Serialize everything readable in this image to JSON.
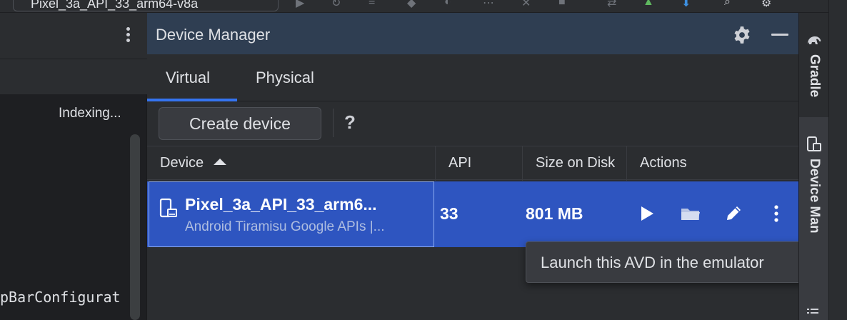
{
  "toolbar": {
    "run_config": "Pixel_3a_API_33_arm64-v8a"
  },
  "left_panel": {
    "status": "Indexing...",
    "code_fragment": "pBarConfigurat"
  },
  "device_manager": {
    "title": "Device Manager",
    "tabs": [
      {
        "label": "Virtual",
        "selected": true
      },
      {
        "label": "Physical",
        "selected": false
      }
    ],
    "create_button": "Create device",
    "help": "?",
    "columns": {
      "device": "Device",
      "api": "API",
      "size": "Size on Disk",
      "actions": "Actions"
    },
    "rows": [
      {
        "name": "Pixel_3a_API_33_arm6...",
        "subtitle": "Android Tiramisu Google APIs |...",
        "api": "33",
        "size": "801 MB"
      }
    ],
    "tooltip": "Launch this AVD in the emulator"
  },
  "right_strip": {
    "gradle": "Gradle",
    "device_manager": "Device Man"
  },
  "colors": {
    "accent": "#3574f0",
    "selection": "#2e55c0",
    "title_bar": "#2f3e52"
  }
}
